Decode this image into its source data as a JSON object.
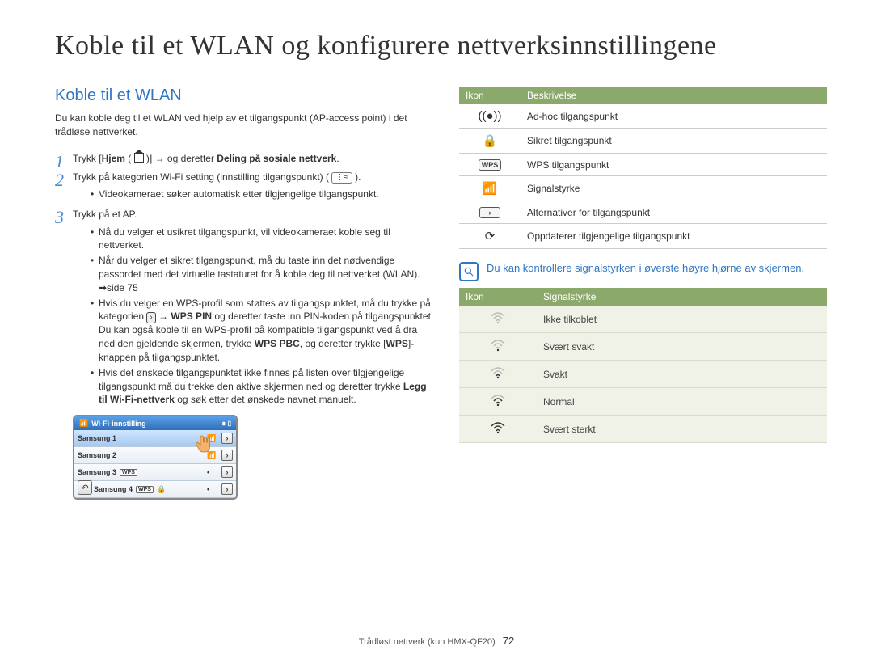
{
  "title": "Koble til et WLAN og konfigurere nettverksinnstillingene",
  "section_title": "Koble til et WLAN",
  "intro": "Du kan koble deg til et WLAN ved hjelp av et tilgangspunkt (AP-access point) i det trådløse nettverket.",
  "steps": {
    "s1": {
      "pre": "Trykk [",
      "hjem": "Hjem",
      "mid": " ( ",
      "post": " )] → og deretter ",
      "bold": "Deling på sosiale nettverk",
      "end": "."
    },
    "s2": {
      "text": "Trykk på kategorien Wi-Fi setting (innstilling tilgangspunkt) ( ",
      "end": " ).",
      "sub1": "Videokameraet søker automatisk etter tilgjengelige tilgangspunkt."
    },
    "s3": {
      "text": "Trykk på et AP.",
      "sub1": "Nå du velger et usikret tilgangspunkt, vil videokameraet koble seg til nettverket.",
      "sub2": "Når du velger et sikret tilgangspunkt, må du taste inn det nødvendige passordet med det virtuelle tastaturet for å koble deg til nettverket (WLAN). ➡side 75",
      "sub3_a": "Hvis du velger en WPS-profil som støttes av tilgangspunktet, må du trykke på kategorien ",
      "sub3_b": " → ",
      "sub3_wps": "WPS PIN",
      "sub3_c": " og deretter taste inn PIN-koden på tilgangspunktet. Du kan også koble til en WPS-profil på kompatible tilgangspunkt ved å dra ned den gjeldende skjermen, trykke ",
      "sub3_pbc": "WPS PBC",
      "sub3_d": ", og deretter trykke [",
      "sub3_wpsbtn": "WPS",
      "sub3_e": "]-knappen på tilgangspunktet.",
      "sub4_a": "Hvis det ønskede tilgangspunktet ikke finnes på listen over tilgjengelige tilgangspunkt må du trekke den aktive skjermen ned og deretter trykke ",
      "sub4_b": "Legg til Wi-Fi-nettverk",
      "sub4_c": " og søk etter det ønskede navnet manuelt."
    }
  },
  "shot": {
    "title": "Wi-Fi-innstilling",
    "rows": [
      {
        "name": "Samsung 1"
      },
      {
        "name": "Samsung 2"
      },
      {
        "name": "Samsung 3"
      },
      {
        "name": "Samsung 4"
      }
    ]
  },
  "icon_table": {
    "head_icon": "Ikon",
    "head_desc": "Beskrivelse",
    "rows": [
      {
        "icon": "adhoc",
        "desc": "Ad-hoc tilgangspunkt"
      },
      {
        "icon": "lock",
        "desc": "Sikret tilgangspunkt"
      },
      {
        "icon": "wps",
        "desc": "WPS tilgangspunkt"
      },
      {
        "icon": "wifi",
        "desc": "Signalstyrke"
      },
      {
        "icon": "arrow",
        "desc": "Alternativer for tilgangspunkt"
      },
      {
        "icon": "refresh",
        "desc": "Oppdaterer tilgjengelige tilgangspunkt"
      }
    ]
  },
  "note": "Du kan kontrollere signalstyrken i øverste høyre hjørne av skjermen.",
  "signal_table": {
    "head_icon": "Ikon",
    "head_sig": "Signalstyrke",
    "rows": [
      {
        "bars": 0,
        "label": "Ikke tilkoblet"
      },
      {
        "bars": 1,
        "label": "Svært svakt"
      },
      {
        "bars": 2,
        "label": "Svakt"
      },
      {
        "bars": 3,
        "label": "Normal"
      },
      {
        "bars": 4,
        "label": "Svært sterkt"
      }
    ]
  },
  "footer": {
    "text": "Trådløst nettverk (kun HMX-QF20)",
    "page": "72"
  }
}
